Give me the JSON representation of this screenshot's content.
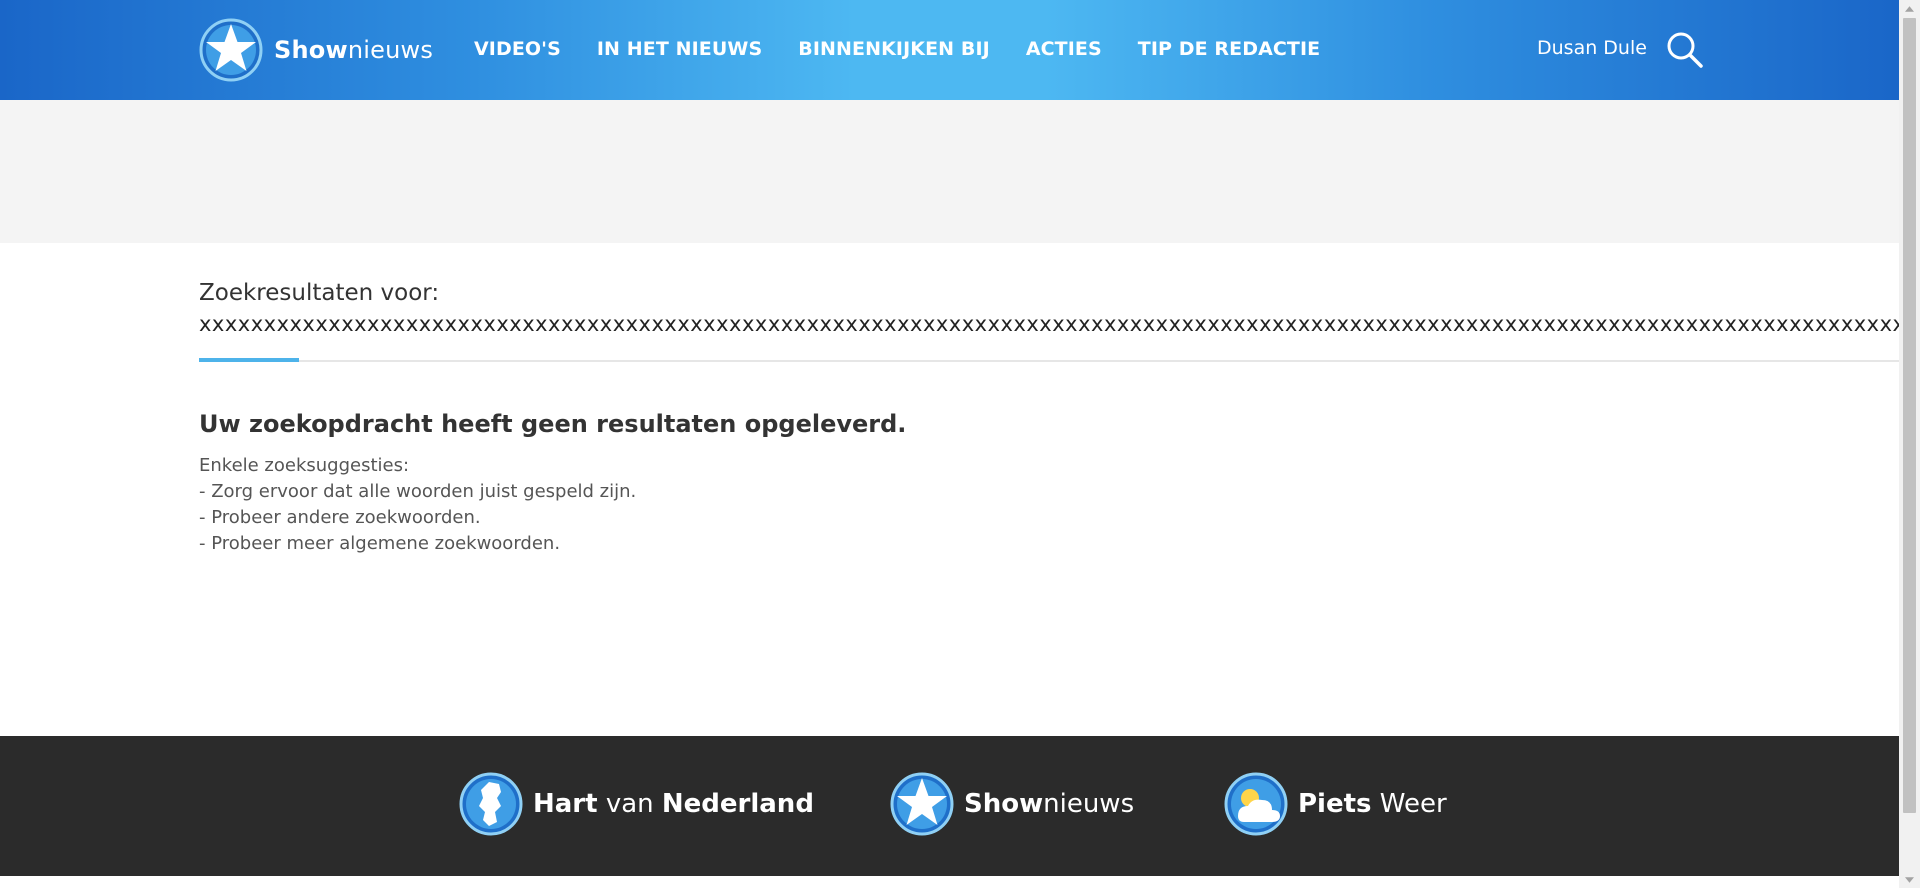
{
  "header": {
    "logo": {
      "bold": "Show",
      "light": "nieuws"
    },
    "nav": [
      {
        "label": "VIDEO'S"
      },
      {
        "label": "IN HET NIEUWS"
      },
      {
        "label": "BINNENKIJKEN BIJ"
      },
      {
        "label": "ACTIES"
      },
      {
        "label": "TIP DE REDACTIE"
      }
    ],
    "user_name": "Dusan Dule",
    "search_icon": "search-icon"
  },
  "search": {
    "label": "Zoekresultaten voor:",
    "query": "xxxxxxxxxxxxxxxxxxxxxxxxxxxxxxxxxxxxxxxxxxxxxxxxxxxxxxxxxxxxxxxxxxxxxxxxxxxxxxxxxxxxxxxxxxxxxxxxxxxxxxxxxxxxxxxxxxxxxxxxxxxxxxxxxxxxxxxxxxxxxxxxxxxxxxxxxxxxxxxxxxxxxxxxxxxxxxxxxxxxxxxxxxxxxxxxxxxxxxxxxxxx"
  },
  "results": {
    "heading": "Uw zoekopdracht heeft geen resultaten opgeleverd.",
    "tips": [
      "Enkele zoeksuggesties:",
      "- Zorg ervoor dat alle woorden juist gespeld zijn.",
      "- Probeer andere zoekwoorden.",
      "- Probeer meer algemene zoekwoorden."
    ]
  },
  "footer": {
    "brands": [
      {
        "bold": "Hart",
        "light": " van ",
        "bold2": "Nederland",
        "icon": "netherlands-map-icon"
      },
      {
        "bold": "Show",
        "light": "nieuws",
        "bold2": "",
        "icon": "star-icon"
      },
      {
        "bold": "Piets",
        "light": " Weer",
        "bold2": "",
        "icon": "weather-cloud-icon"
      }
    ]
  },
  "colors": {
    "header_dark": "#1a66c8",
    "header_light": "#4db8f2",
    "accent": "#4db3ea",
    "footer_bg": "#2b2b2b",
    "ad_band_bg": "#f4f4f4"
  }
}
